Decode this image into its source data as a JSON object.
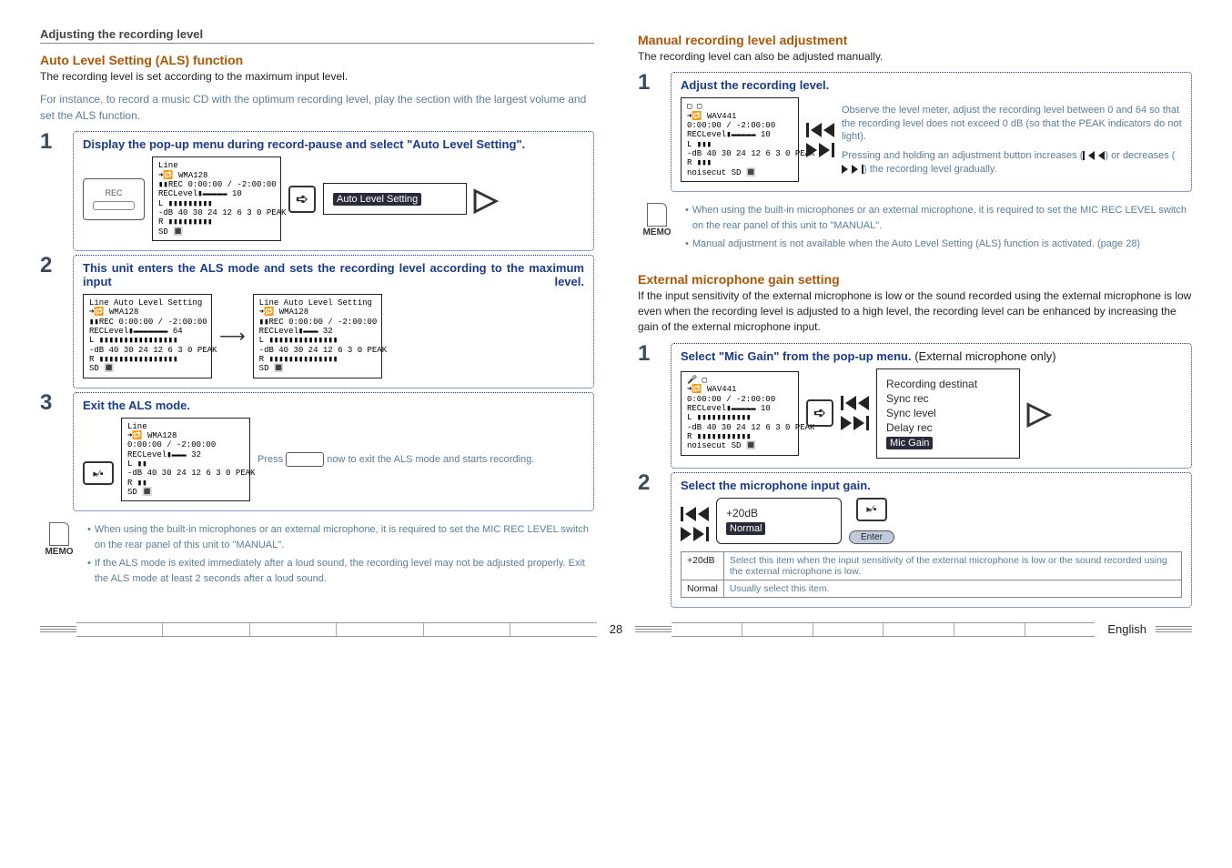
{
  "header": {
    "section_title": "Adjusting the recording level"
  },
  "left": {
    "title": "Auto Level Setting (ALS) function",
    "line1": "The recording level is set according to the maximum input level.",
    "line2": "For instance, to record a music CD with the optimum recording level, play the section with the largest volume and set the ALS function.",
    "step1": {
      "num": "1",
      "title": "Display the pop-up menu during record-pause and select \"Auto Level Setting\".",
      "rec_label": "REC",
      "menu_item": "Auto Level Setting",
      "screen": {
        "l1": "Line",
        "l2": "➜🔂 WMA128",
        "l3": "▮▮REC  0:00:00 / -2:00:00",
        "l4": "RECLevel▮▬▬▬▬▬        10",
        "l5": "L ▮▮▮▮▮▮▮▮▮         ",
        "l6": "-dB 40 30 24   12 6 3 0 PEAK",
        "l7": "R ▮▮▮▮▮▮▮▮▮         ",
        "l8": "          SD       🔳"
      }
    },
    "step2": {
      "num": "2",
      "title": "This unit enters the ALS mode and sets the recording level according to the maximum input level.",
      "als_label": "Auto Level Setting",
      "screenA": {
        "l1": "Line Auto Level Setting",
        "l2": "➜🔂 WMA128",
        "l3": "▮▮REC  0:00:00 / -2:00:00",
        "l4": "RECLevel▮▬▬▬▬▬▬▬    64",
        "l5": "L ▮▮▮▮▮▮▮▮▮▮▮▮▮▮▮▮",
        "l6": "-dB 40 30 24   12 6 3 0 PEAK",
        "l7": "R ▮▮▮▮▮▮▮▮▮▮▮▮▮▮▮▮",
        "l8": "          SD       🔳"
      },
      "screenB": {
        "l1": "Line Auto Level Setting",
        "l2": "➜🔂 WMA128",
        "l3": "▮▮REC  0:00:00 / -2:00:00",
        "l4": "RECLevel▮▬▬▬         32",
        "l5": "L ▮▮▮▮▮▮▮▮▮▮▮▮▮▮  ",
        "l6": "-dB 40 30 24   12 6 3 0 PEAK",
        "l7": "R ▮▮▮▮▮▮▮▮▮▮▮▮▮▮  ",
        "l8": "          SD       🔳"
      }
    },
    "step3": {
      "num": "3",
      "title": "Exit the ALS mode.",
      "note_a": "Press ",
      "note_b": " now to exit the ALS mode and starts recording.",
      "screen": {
        "l1": "Line",
        "l2": "➜🔂 WMA128",
        "l3": "       0:00:00 / -2:00:00",
        "l4": "RECLevel▮▬▬▬         32",
        "l5": "L ▮▮             ",
        "l6": "-dB 40 30 24   12 6 3 0 PEAK",
        "l7": "R ▮▮             ",
        "l8": "          SD       🔳"
      }
    },
    "memo": {
      "label": "MEMO",
      "b1": "When using the built-in microphones or an external microphone, it is required to set the MIC REC LEVEL switch on the rear panel of this unit to \"MANUAL\".",
      "b2": "If the ALS mode is exited immediately after a loud sound, the recording level may not be adjusted properly. Exit the ALS mode at least 2 seconds after a loud sound."
    }
  },
  "right": {
    "manual": {
      "title": "Manual recording level adjustment",
      "intro": "The recording level can also be adjusted manually.",
      "step1": {
        "num": "1",
        "title": "Adjust the recording level.",
        "desc1": "Observe the level meter, adjust the recording level between 0 and 64 so that the recording level does not exceed 0 dB (so that the PEAK indicators do not light).",
        "desc2a": "Pressing and holding an adjustment button increases (",
        "desc2b": ") or decreases (",
        "desc2c": ") the recording level gradually.",
        "screen": {
          "l1": "▢ ▢",
          "l2": "➜🔂 WAV441",
          "l3": "       0:00:00 / -2:00:00",
          "l4": "RECLevel▮▬▬▬▬▬        10",
          "l5": "L ▮▮▮            ",
          "l6": "-dB 40 30 24   12 6 3 0 PEAK",
          "l7": "R ▮▮▮            ",
          "l8": "   noisecut  SD    🔳"
        }
      },
      "memo": {
        "label": "MEMO",
        "b1": "When using the built-in microphones or an external microphone, it is required to set the MIC REC LEVEL switch on the rear panel of this unit to \"MANUAL\".",
        "b2": "Manual adjustment is not available when the Auto Level Setting (ALS) function is activated. (page 28)"
      }
    },
    "ext": {
      "title": "External microphone gain setting",
      "intro": "If the input sensitivity of the external microphone is low or the sound recorded using the external microphone is low even when the recording level is adjusted to a high level, the recording level can be enhanced by increasing the gain of the external microphone input.",
      "step1": {
        "num": "1",
        "title_a": "Select \"Mic Gain\" from the pop-up menu.",
        "title_b": " (External microphone only)",
        "menu": {
          "i1": "Recording destinat",
          "i2": "Sync rec",
          "i3": "Sync level",
          "i4": "Delay rec",
          "i5": "Mic Gain"
        },
        "screen": {
          "l1": "🎤 ▢",
          "l2": "➜🔂 WAV441",
          "l3": "       0:00:00 / -2:00:00",
          "l4": "RECLevel▮▬▬▬▬▬        10",
          "l5": "L ▮▮▮▮▮▮▮▮▮▮▮     ",
          "l6": "-dB 40 30 24   12 6 3 0 PEAK",
          "l7": "R ▮▮▮▮▮▮▮▮▮▮▮     ",
          "l8": "   noisecut  SD    🔳"
        }
      },
      "step2": {
        "num": "2",
        "title": "Select the microphone input gain.",
        "opt1": "+20dB",
        "opt2": "Normal",
        "table": {
          "r1c1": "+20dB",
          "r1c2": "Select this item when the input sensitivity of the external microphone is low or the sound recorded using the external microphone is low.",
          "r2c1": "Normal",
          "r2c2": "Usually select this item."
        },
        "enter": "Enter"
      }
    }
  },
  "footer": {
    "page": "28",
    "lang": "English"
  }
}
